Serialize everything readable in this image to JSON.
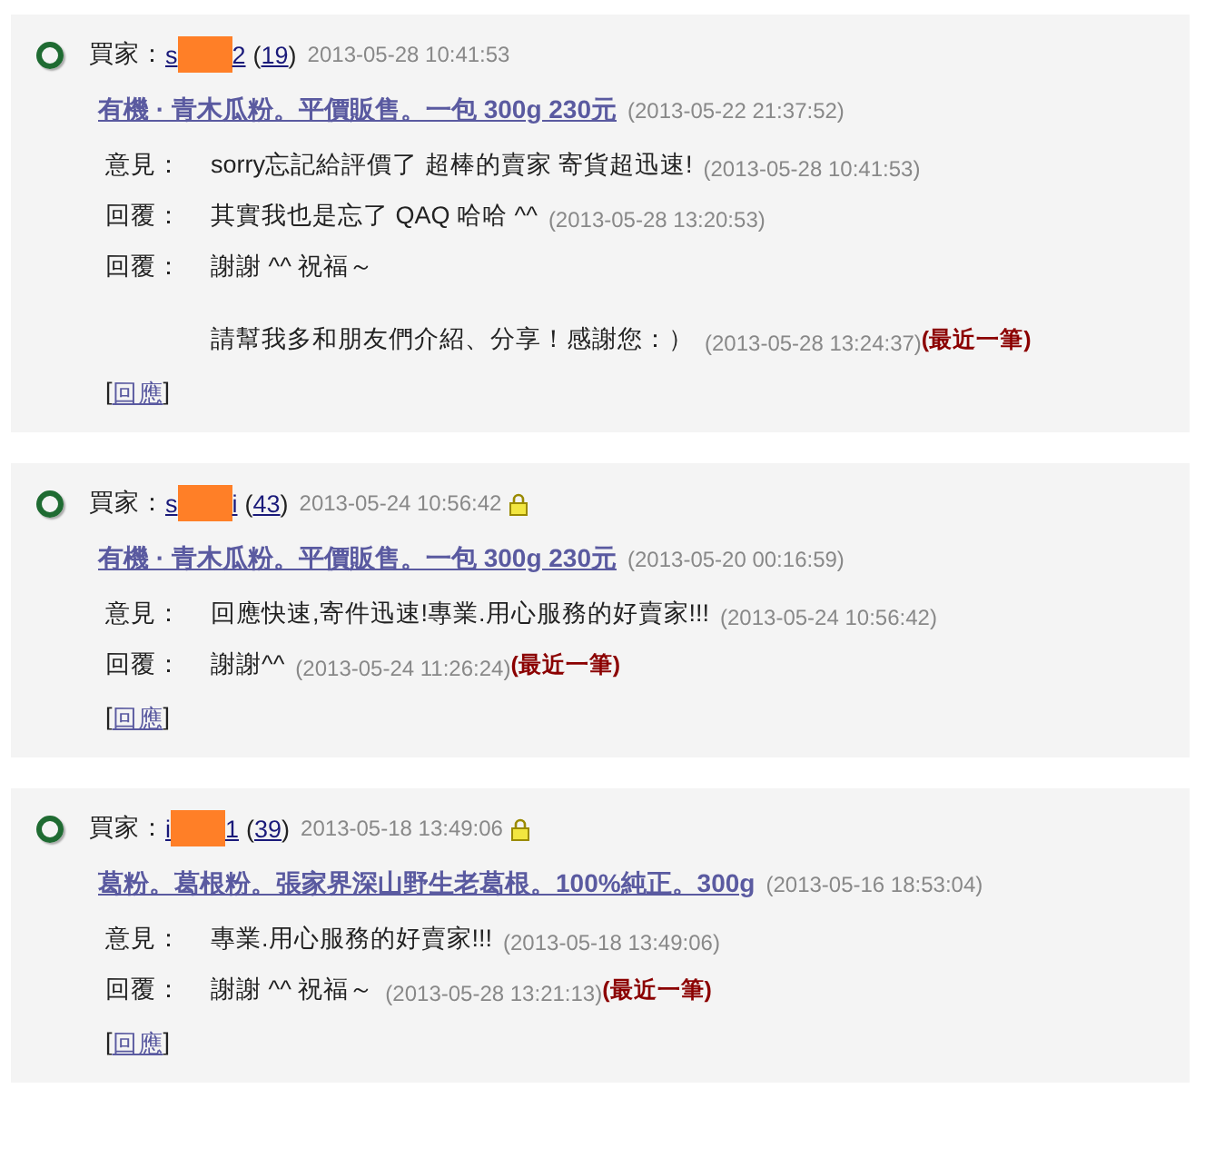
{
  "cards": [
    {
      "buyer_label": "買家：",
      "name_start": "s",
      "name_end": "2",
      "count_open": "(",
      "count": "19",
      "count_close": ")",
      "time": "2013-05-28 10:41:53",
      "locked": false,
      "item": "有機 · 青木瓜粉。平價販售。一包 300g 230元",
      "item_time": "(2013-05-22 21:37:52)",
      "entries": [
        {
          "label": "意見：",
          "text": "sorry忘記給評價了 超棒的賣家 寄貨超迅速!",
          "time": "(2013-05-28 10:41:53)"
        },
        {
          "label": "回覆：",
          "text": "其實我也是忘了 QAQ 哈哈 ^^",
          "time": "(2013-05-28 13:20:53)"
        },
        {
          "label": "回覆：",
          "text": "謝謝 ^^ 祝福～"
        },
        {
          "text": "請幫我多和朋友們介紹、分享！感謝您：）",
          "time": "(2013-05-28 13:24:37)",
          "tag": "(最近一筆)"
        }
      ],
      "reply_open": "[",
      "reply": "回應",
      "reply_close": "]"
    },
    {
      "buyer_label": "買家：",
      "name_start": "s",
      "name_end": "i",
      "count_open": "(",
      "count": "43",
      "count_close": ")",
      "time": "2013-05-24 10:56:42",
      "locked": true,
      "item": "有機 · 青木瓜粉。平價販售。一包 300g 230元",
      "item_time": "(2013-05-20 00:16:59)",
      "entries": [
        {
          "label": "意見：",
          "text": "回應快速,寄件迅速!專業.用心服務的好賣家!!!",
          "time": "(2013-05-24 10:56:42)"
        },
        {
          "label": "回覆：",
          "text": "謝謝^^",
          "time": "(2013-05-24 11:26:24)",
          "tag": "(最近一筆)"
        }
      ],
      "reply_open": "[",
      "reply": "回應",
      "reply_close": "]"
    },
    {
      "buyer_label": "買家：",
      "name_start": "i",
      "name_end": "1",
      "count_open": "(",
      "count": "39",
      "count_close": ")",
      "time": "2013-05-18 13:49:06",
      "locked": true,
      "item": "葛粉。葛根粉。張家界深山野生老葛根。100%純正。300g",
      "item_time": "(2013-05-16 18:53:04)",
      "entries": [
        {
          "label": "意見：",
          "text": "專業.用心服務的好賣家!!!",
          "time": "(2013-05-18 13:49:06)"
        },
        {
          "label": "回覆：",
          "text": "謝謝 ^^ 祝福～",
          "time": "(2013-05-28 13:21:13)",
          "tag": "(最近一筆)"
        }
      ],
      "reply_open": "[",
      "reply": "回應",
      "reply_close": "]"
    }
  ]
}
